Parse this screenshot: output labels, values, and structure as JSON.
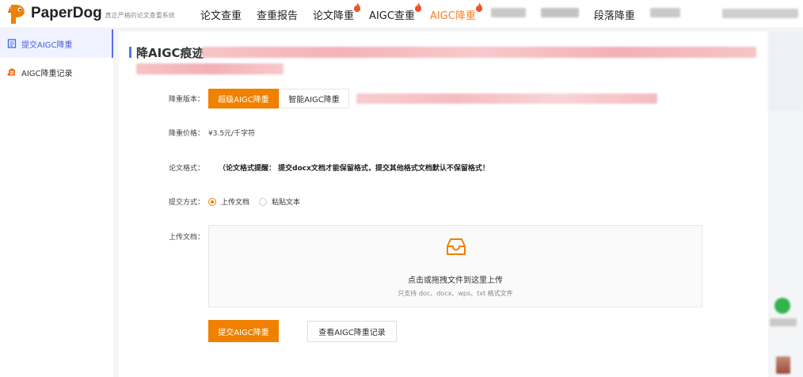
{
  "brand": {
    "name": "PaperDog",
    "slogan": "真正严格的论文查重系统"
  },
  "nav": {
    "items": [
      {
        "label": "论文查重",
        "hot": false,
        "active": false
      },
      {
        "label": "查重报告",
        "hot": false,
        "active": false
      },
      {
        "label": "论文降重",
        "hot": true,
        "active": false
      },
      {
        "label": "AIGC查重",
        "hot": true,
        "active": false
      },
      {
        "label": "AIGC降重",
        "hot": true,
        "active": true
      },
      {
        "label": "",
        "blurred": true
      },
      {
        "label": "",
        "blurred": true
      },
      {
        "label": "段落降重",
        "hot": false,
        "active": false
      },
      {
        "label": "",
        "blurred": true
      }
    ]
  },
  "sidebar": {
    "items": [
      {
        "label": "提交AIGC降重",
        "icon": "document-icon",
        "active": true
      },
      {
        "label": "AIGC降重记录",
        "icon": "history-icon",
        "active": false
      }
    ]
  },
  "page": {
    "title": "降AIGC痕迹"
  },
  "form": {
    "version_label": "降重版本：",
    "versions": [
      {
        "label": "超级AIGC降重",
        "selected": true
      },
      {
        "label": "智能AIGC降重",
        "selected": false
      }
    ],
    "price_label": "降重价格：",
    "price_value": "¥3.5元/千字符",
    "format_label": "论文格式：",
    "format_note": "（论文格式提醒：  提交docx文档才能保留格式，提交其他格式文档默认不保留格式！",
    "submit_method_label": "提交方式：",
    "submit_methods": [
      {
        "label": "上传文档",
        "selected": true
      },
      {
        "label": "粘贴文本",
        "selected": false
      }
    ],
    "upload_label": "上传文档：",
    "upload_main": "点击或拖拽文件到这里上传",
    "upload_hint": "只支持 doc、docx、wps、txt 格式文件",
    "submit_button": "提交AIGC降重",
    "records_button": "查看AIGC降重记录"
  },
  "colors": {
    "accent": "#f08000",
    "nav_active": "#f5822a",
    "sidebar_active": "#4960d6",
    "title_bar": "#4a7bf0"
  }
}
